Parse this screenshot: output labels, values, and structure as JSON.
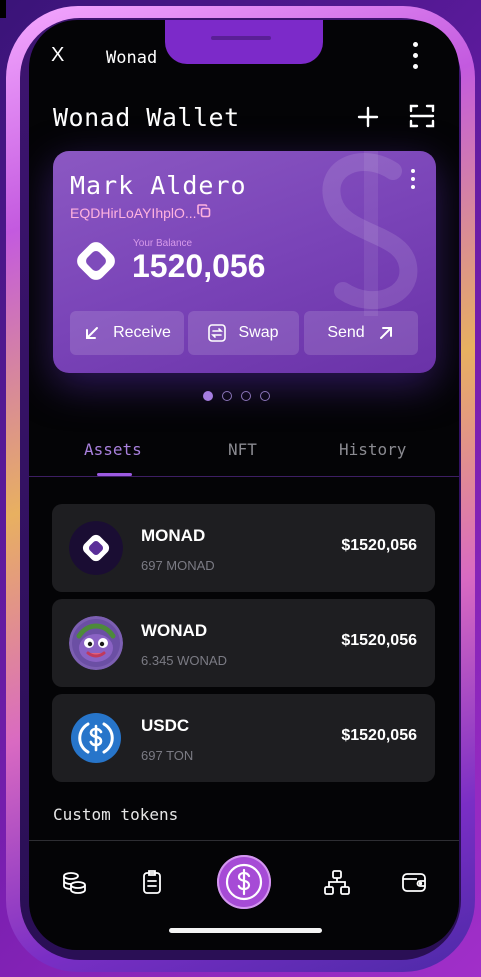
{
  "topbar": {
    "close": "X",
    "title": "Wonad"
  },
  "header": {
    "title": "Wonad Wallet"
  },
  "card": {
    "name": "Mark Aldero",
    "address": "EQDHirLoAYIhplO...",
    "balance_label": "Your Balance",
    "balance": "1520,056",
    "buttons": [
      {
        "label": "Receive",
        "icon": "arrow-down-left-icon"
      },
      {
        "label": "Swap",
        "icon": "swap-icon"
      },
      {
        "label": "Send",
        "icon": "arrow-up-right-icon"
      }
    ]
  },
  "pager": {
    "count": 4,
    "active": 0
  },
  "tabs": [
    {
      "label": "Assets",
      "active": true
    },
    {
      "label": "NFT",
      "active": false
    },
    {
      "label": "History",
      "active": false
    }
  ],
  "assets": [
    {
      "name": "MONAD",
      "amount": "697 MONAD",
      "value": "$1520,056"
    },
    {
      "name": "WONAD",
      "amount": "6.345  WONAD",
      "value": "$1520,056"
    },
    {
      "name": "USDC",
      "amount": "697 TON",
      "value": "$1520,056"
    }
  ],
  "custom_tokens": {
    "title": "Custom tokens"
  },
  "bottom_nav": [
    "coins-icon",
    "clipboard-icon",
    "dollar-icon",
    "network-icon",
    "wallet-icon"
  ],
  "colors": {
    "accent": "#9c5ae0",
    "card": "#7a44b8",
    "address": "#ffb2df"
  }
}
